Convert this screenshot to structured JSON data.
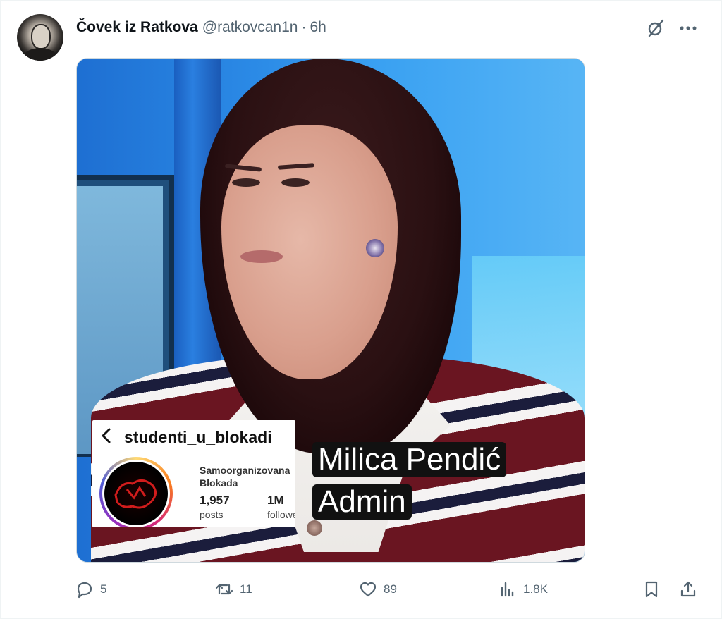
{
  "tweet": {
    "display_name": "Čovek iz Ratkova",
    "handle": "@ratkovcan1n",
    "separator": "·",
    "time": "6h"
  },
  "header_icons": {
    "grok": "grok-icon",
    "more": "more-icon"
  },
  "media": {
    "instagram_card": {
      "username": "studenti_u_blokadi",
      "bio_line1": "Samoorganizovana",
      "bio_line2": "Blokada",
      "posts_count": "1,957",
      "posts_label": "posts",
      "followers_count": "1M",
      "followers_label": "followers"
    },
    "caption_line1": "Milica Pendić",
    "caption_line2": "Admin"
  },
  "actions": {
    "replies": "5",
    "reposts": "11",
    "likes": "89",
    "views": "1.8K"
  },
  "colors": {
    "text_primary": "#0f1419",
    "text_secondary": "#536471",
    "border": "#eff3f4"
  }
}
